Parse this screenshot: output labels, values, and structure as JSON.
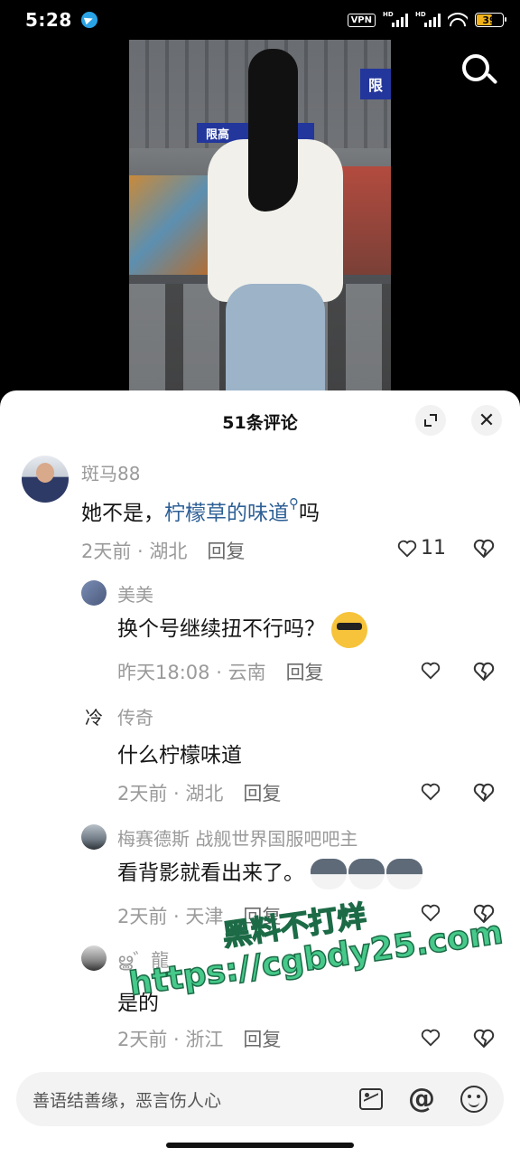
{
  "status_bar": {
    "time": "5:28",
    "vpn": "VPN",
    "hd1": "HD",
    "hd2": "HD",
    "battery": "39"
  },
  "video": {
    "sign_text": "限高",
    "sign_text2": "限"
  },
  "sheet": {
    "title": "51条评论"
  },
  "comments": [
    {
      "user": "斑马88",
      "text_prefix": "她不是，",
      "text_link": "柠檬草的味道",
      "text_suffix": "吗",
      "time": "2天前",
      "location": "湖北",
      "reply_label": "回复",
      "likes": "11"
    },
    {
      "user": "美美",
      "text": "换个号继续扭不行吗？",
      "time": "昨天18:08",
      "location": "云南",
      "reply_label": "回复"
    },
    {
      "user": "传奇",
      "avatar_char": "冷",
      "text": "什么柠檬味道",
      "time": "2天前",
      "location": "湖北",
      "reply_label": "回复"
    },
    {
      "user": "梅赛德斯 战舰世界国服吧吧主",
      "text": "看背影就看出来了。",
      "time": "2天前",
      "location": "天津",
      "reply_label": "回复"
    },
    {
      "user": "ൠ゛龍",
      "text": "是的",
      "time": "2天前",
      "location": "浙江",
      "reply_label": "回复"
    }
  ],
  "watermark": {
    "line1": "黑料不打烊",
    "line2": "https://cgbdy25.com"
  },
  "input": {
    "placeholder": "善语结善缘，恶言伤人心"
  },
  "icons": [
    "search-icon",
    "expand-icon",
    "close-icon",
    "heart-icon",
    "dislike-icon",
    "image-icon",
    "at-icon",
    "emoji-icon"
  ],
  "colors": {
    "link": "#2d5f95",
    "meta": "#9a9a9a",
    "sheet_bg": "#ffffff",
    "watermark": "#46c98a"
  }
}
